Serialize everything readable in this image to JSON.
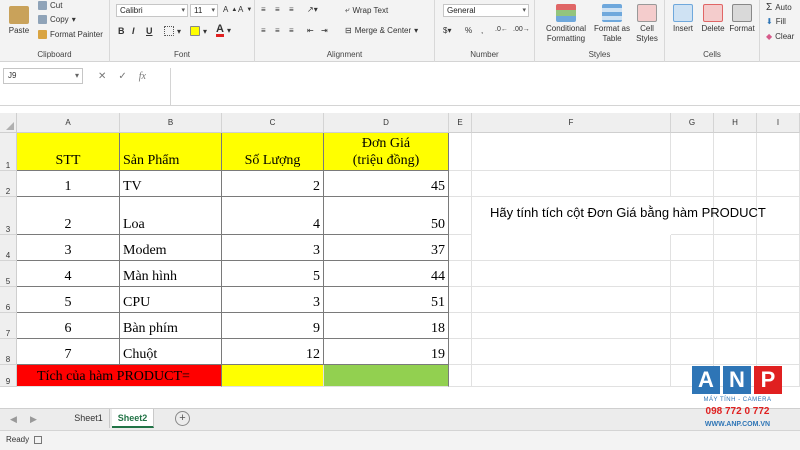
{
  "ribbon": {
    "clipboard": {
      "paste": "Paste",
      "cut": "Cut",
      "copy": "Copy",
      "format_painter": "Format Painter",
      "label": "Clipboard"
    },
    "font": {
      "name": "Calibri",
      "size": "11",
      "label": "Font",
      "bold": "B",
      "italic": "I",
      "underline": "U"
    },
    "alignment": {
      "wrap": "Wrap Text",
      "merge": "Merge & Center",
      "label": "Alignment"
    },
    "number": {
      "format": "General",
      "label": "Number"
    },
    "styles": {
      "conditional": "Conditional\nFormatting",
      "format_as_table": "Format as\nTable",
      "cell_styles": "Cell\nStyles",
      "label": "Styles"
    },
    "cells": {
      "insert": "Insert",
      "delete": "Delete",
      "format": "Format",
      "label": "Cells"
    },
    "editing": {
      "autosum": "Auto",
      "fill": "Fill",
      "clear": "Clear"
    }
  },
  "formula_bar": {
    "name_box": "J9",
    "fx": "fx"
  },
  "columns": [
    "A",
    "B",
    "C",
    "D",
    "E",
    "F",
    "G",
    "H",
    "I"
  ],
  "rows": [
    "1",
    "2",
    "3",
    "4",
    "5",
    "6",
    "7",
    "8",
    "9"
  ],
  "headers": {
    "stt": "STT",
    "product": "Sản Phẩm",
    "qty": "Số Lượng",
    "price_line1": "Đơn Giá",
    "price_line2": "(triệu đồng)"
  },
  "table": [
    {
      "stt": "1",
      "product": "TV",
      "qty": "2",
      "price": "45"
    },
    {
      "stt": "2",
      "product": "Loa",
      "qty": "4",
      "price": "50"
    },
    {
      "stt": "3",
      "product": "Modem",
      "qty": "3",
      "price": "37"
    },
    {
      "stt": "4",
      "product": "Màn hình",
      "qty": "5",
      "price": "44"
    },
    {
      "stt": "5",
      "product": "CPU",
      "qty": "3",
      "price": "51"
    },
    {
      "stt": "6",
      "product": "Bàn phím",
      "qty": "9",
      "price": "18"
    },
    {
      "stt": "7",
      "product": "Chuột",
      "qty": "12",
      "price": "19"
    }
  ],
  "product_label": "Tích của hàm PRODUCT=",
  "instruction": "Hãy tính tích cột Đơn Giá bằng hàm PRODUCT",
  "sheets": [
    "Sheet1",
    "Sheet2"
  ],
  "active_sheet": "Sheet2",
  "status": "Ready",
  "watermark": {
    "letters": [
      "A",
      "N",
      "P"
    ],
    "line1": "MÁY TÍNH - CAMERA",
    "phone": "098 772 0 772",
    "site": "WWW.ANP.COM.VN"
  },
  "colors": {
    "header_yellow": "#ffff00",
    "label_red": "#ff0000",
    "result_green": "#92d050",
    "excel_green": "#217346",
    "anp_blue": "#2e75b6",
    "anp_red": "#e02020"
  }
}
